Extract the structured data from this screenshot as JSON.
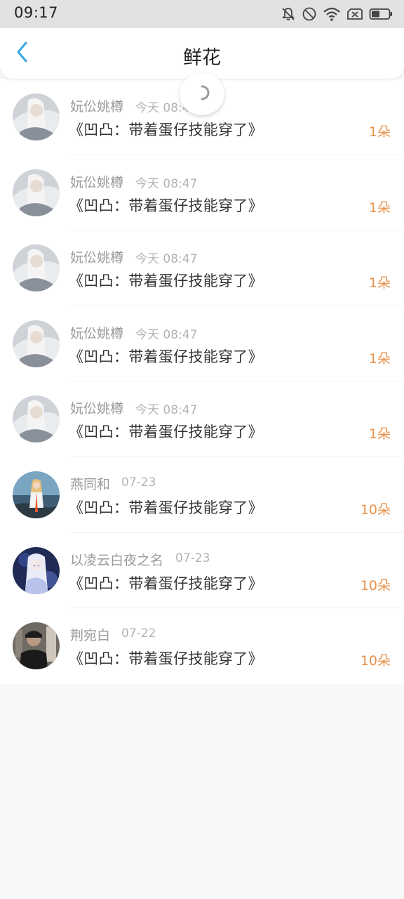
{
  "status_bar": {
    "time": "09:17",
    "icons": [
      "bell-off-icon",
      "do-not-disturb-icon",
      "wifi-icon",
      "no-sim-icon",
      "battery-icon"
    ]
  },
  "header": {
    "back_icon": "chevron-left-icon",
    "title": "鲜花"
  },
  "colors": {
    "accent_blue": "#3aa7e6",
    "count_orange": "#e8914a"
  },
  "items": [
    {
      "name": "妧伀姚樽",
      "time": "今天 08:4",
      "book": "《凹凸：带着蛋仔技能穿了》",
      "count": "1朵",
      "avatar": "avatar-white-hair"
    },
    {
      "name": "妧伀姚樽",
      "time": "今天 08:47",
      "book": "《凹凸：带着蛋仔技能穿了》",
      "count": "1朵",
      "avatar": "avatar-white-hair"
    },
    {
      "name": "妧伀姚樽",
      "time": "今天 08:47",
      "book": "《凹凸：带着蛋仔技能穿了》",
      "count": "1朵",
      "avatar": "avatar-white-hair"
    },
    {
      "name": "妧伀姚樽",
      "time": "今天 08:47",
      "book": "《凹凸：带着蛋仔技能穿了》",
      "count": "1朵",
      "avatar": "avatar-white-hair"
    },
    {
      "name": "妧伀姚樽",
      "time": "今天 08:47",
      "book": "《凹凸：带着蛋仔技能穿了》",
      "count": "1朵",
      "avatar": "avatar-white-hair"
    },
    {
      "name": "燕同和",
      "time": "07-23",
      "book": "《凹凸：带着蛋仔技能穿了》",
      "count": "10朵",
      "avatar": "avatar-seaside"
    },
    {
      "name": "以凌云白夜之名",
      "time": "07-23",
      "book": "《凹凸：带着蛋仔技能穿了》",
      "count": "10朵",
      "avatar": "avatar-anime-girl"
    },
    {
      "name": "荆宛白",
      "time": "07-22",
      "book": "《凹凸：带着蛋仔技能穿了》",
      "count": "10朵",
      "avatar": "avatar-dark-portrait"
    }
  ]
}
